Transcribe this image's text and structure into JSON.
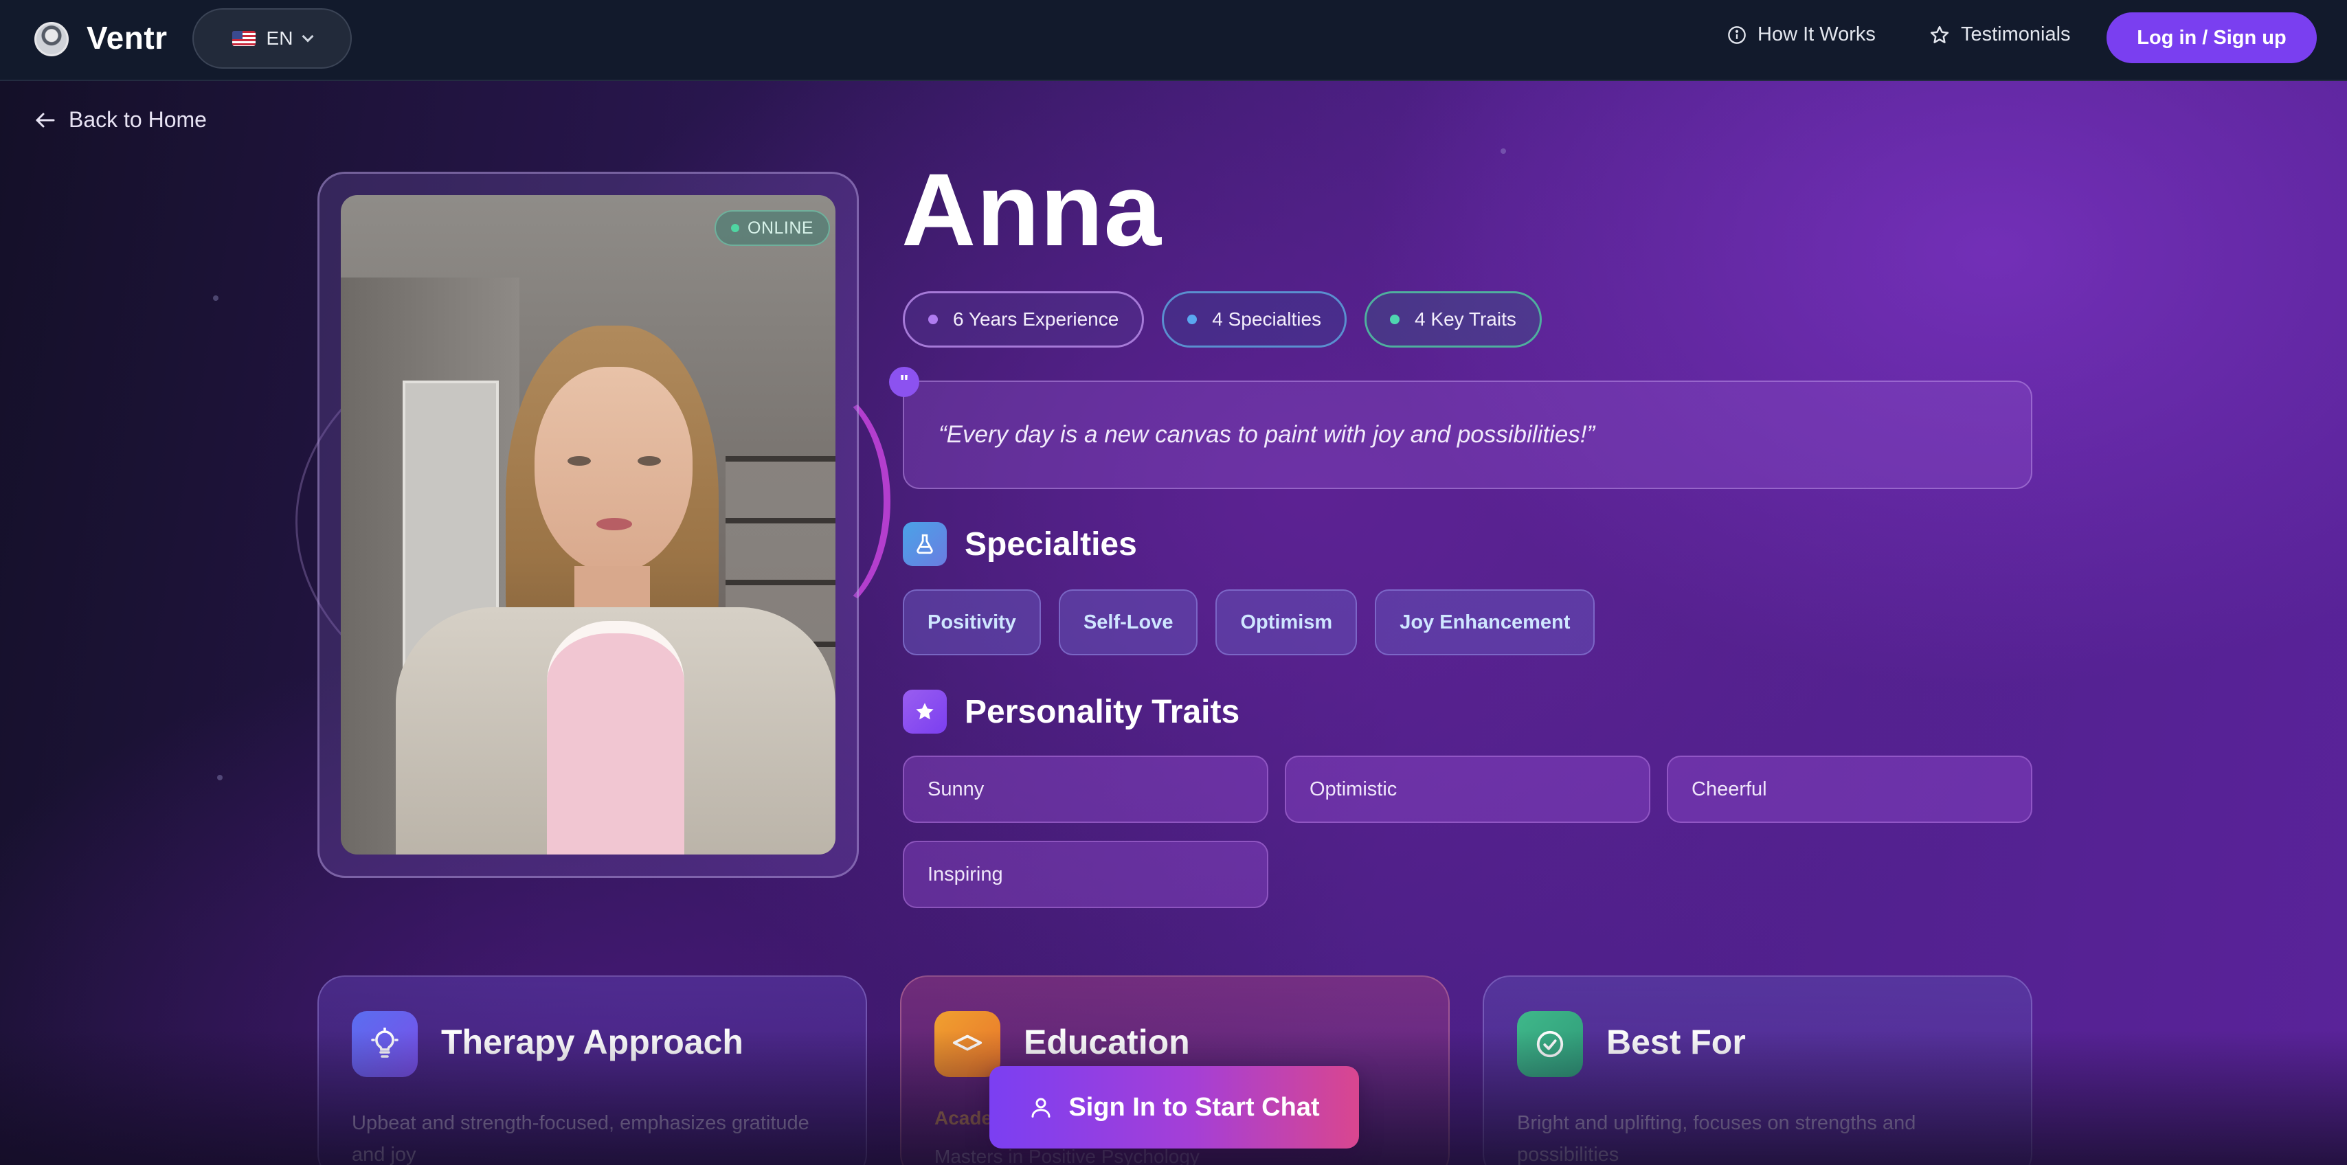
{
  "header": {
    "brand": "Ventr",
    "language": "EN",
    "nav": [
      {
        "label": "How It Works",
        "icon": "info-icon"
      },
      {
        "label": "Testimonials",
        "icon": "star-outline-icon"
      }
    ],
    "login_label": "Log in / Sign up"
  },
  "back_label": "Back to Home",
  "profile": {
    "status": "ONLINE",
    "name": "Anna",
    "stats": [
      {
        "label": "6 Years Experience",
        "color": "#b07cf0"
      },
      {
        "label": "4 Specialties",
        "color": "#5aa8f0"
      },
      {
        "label": "4 Key Traits",
        "color": "#4fd6b0"
      }
    ],
    "quote": "“Every day is a new canvas to paint with joy and possibilities!”",
    "quote_mark": "\"",
    "specialties_title": "Specialties",
    "specialties": [
      "Positivity",
      "Self-Love",
      "Optimism",
      "Joy Enhancement"
    ],
    "traits_title": "Personality Traits",
    "traits": [
      "Sunny",
      "Optimistic",
      "Cheerful",
      "Inspiring"
    ]
  },
  "cards": [
    {
      "title": "Therapy Approach",
      "icon": "lightbulb-icon",
      "desc": "Upbeat and strength-focused, emphasizes gratitude and joy"
    },
    {
      "title": "Education",
      "icon": "graduation-cap-icon",
      "sub": "Acade",
      "sub2": "Masters in Positive Psychology"
    },
    {
      "title": "Best For",
      "icon": "check-circle-icon",
      "desc": "Bright and uplifting, focuses on strengths and possibilities"
    }
  ],
  "cta_label": "Sign In to Start Chat",
  "colors": {
    "accent": "#7a3ff0",
    "online": "#4fd6a2",
    "cta_gradient_end": "#d9468f"
  }
}
